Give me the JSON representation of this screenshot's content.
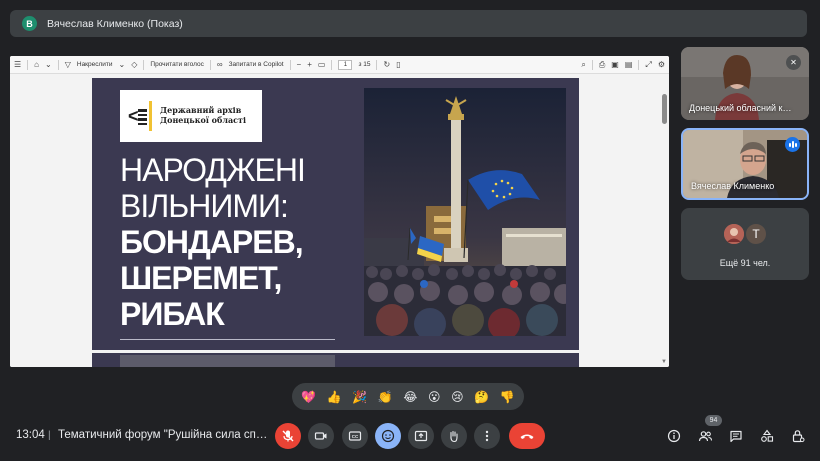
{
  "presenter": {
    "avatar_letter": "В",
    "label": "Вячеслав Клименко (Показ)"
  },
  "pdf_toolbar": {
    "draw_label": "Накреслити",
    "read_aloud_label": "Прочитати вголос",
    "copilot_label": "Запитати в Copilot",
    "zoom_out": "−",
    "zoom_in": "+",
    "current_page": "1",
    "page_total": "з 15"
  },
  "slide": {
    "logo_line1": "Державний архів",
    "logo_line2": "Донецької області",
    "title_line1": "НАРОДЖЕНІ",
    "title_line2": "ВІЛЬНИМИ:",
    "title_line3": "БОНДАРЕВ,",
    "title_line4": "ШЕРЕМЕТ,",
    "title_line5": "РИБАК"
  },
  "participants": [
    {
      "name": "Донецький обласний к…",
      "mic": "off"
    },
    {
      "name": "Вячеслав Клименко",
      "mic": "speaking"
    }
  ],
  "others": {
    "letter": "Т",
    "label": "Ещё 91 чел."
  },
  "reactions": [
    "💖",
    "👍",
    "🎉",
    "👏",
    "😂",
    "😮",
    "😢",
    "🤔",
    "👎"
  ],
  "bottom_bar": {
    "time": "13:04",
    "separator": "|",
    "meeting_title": "Тематичний форум \"Рушійна сила спрот…",
    "participant_count": "94"
  },
  "colors": {
    "background": "#202124",
    "hangup": "#ea4335",
    "accent": "#8ab4f8",
    "slide_bg": "#3b3951"
  }
}
